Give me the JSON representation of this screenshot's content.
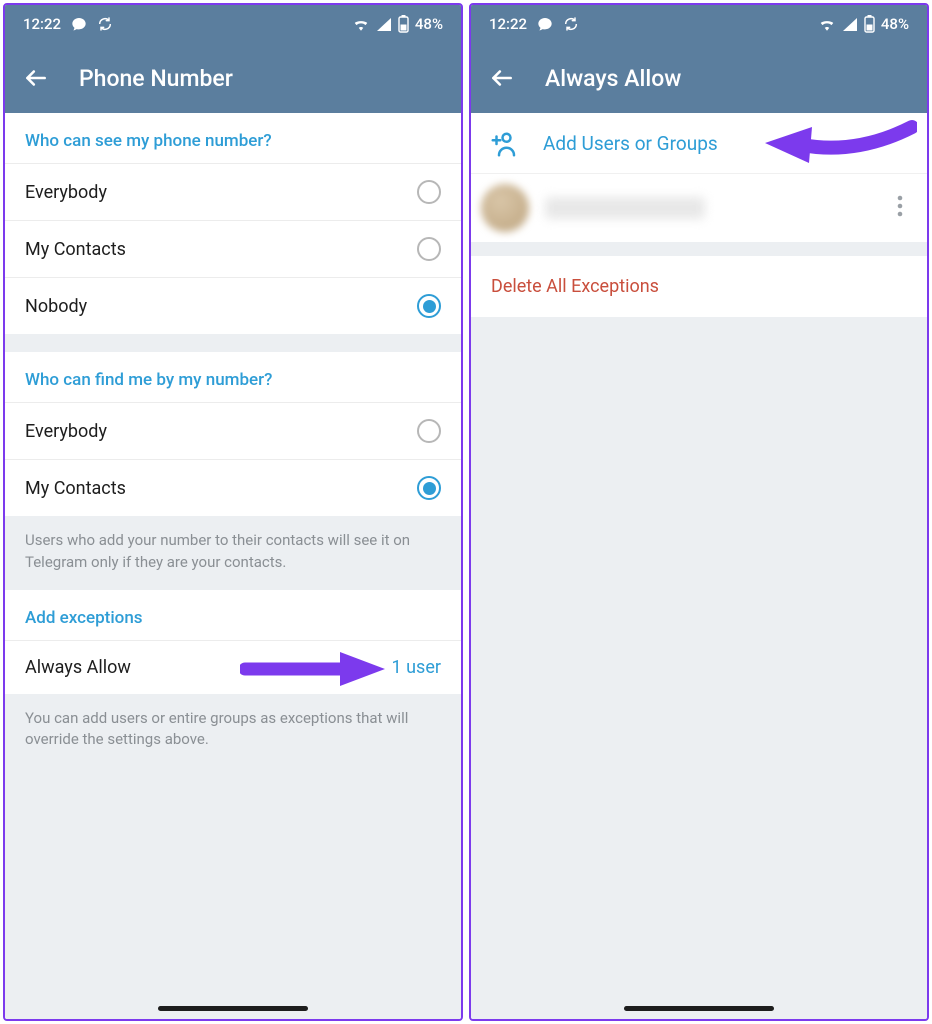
{
  "status": {
    "time": "12:22",
    "battery": "48%"
  },
  "screen1": {
    "title": "Phone Number",
    "section1": {
      "header": "Who can see my phone number?",
      "opt1": "Everybody",
      "opt2": "My Contacts",
      "opt3": "Nobody"
    },
    "section2": {
      "header": "Who can find me by my number?",
      "opt1": "Everybody",
      "opt2": "My Contacts",
      "note": "Users who add your number to their contacts will see it on Telegram only if they are your contacts."
    },
    "section3": {
      "header": "Add exceptions",
      "label": "Always Allow",
      "value": "1 user",
      "note": "You can add users or entire groups as exceptions that will override the settings above."
    }
  },
  "screen2": {
    "title": "Always Allow",
    "add_label": "Add Users or Groups",
    "delete_label": "Delete All Exceptions"
  }
}
